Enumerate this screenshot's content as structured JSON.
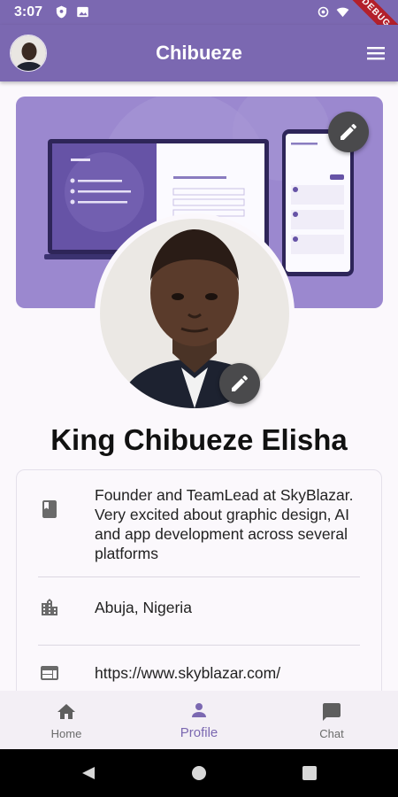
{
  "status_bar": {
    "time": "3:07",
    "icons": [
      "shield-icon",
      "image-icon",
      "data-saver-icon",
      "wifi-icon",
      "battery-icon"
    ],
    "debug_label": "DEBUG"
  },
  "app_bar": {
    "title": "Chibueze",
    "avatar_icon": "avatar",
    "menu_icon": "hamburger-menu-icon"
  },
  "banner": {
    "edit_icon": "pencil-icon"
  },
  "profile": {
    "name": "King Chibueze Elisha",
    "edit_icon": "pencil-icon"
  },
  "info": {
    "bio": "Founder and TeamLead at SkyBlazar. Very excited about graphic design, AI and app development across several platforms",
    "location": "Abuja, Nigeria",
    "website": "https://www.skyblazar.com/"
  },
  "bottom_nav": {
    "items": [
      {
        "label": "Home",
        "icon": "home-icon",
        "active": false
      },
      {
        "label": "Profile",
        "icon": "person-icon",
        "active": true
      },
      {
        "label": "Chat",
        "icon": "chat-icon",
        "active": false
      }
    ]
  },
  "colors": {
    "primary": "#7b68b1",
    "banner": "#9b88cf",
    "fab": "#4a4a4c"
  }
}
